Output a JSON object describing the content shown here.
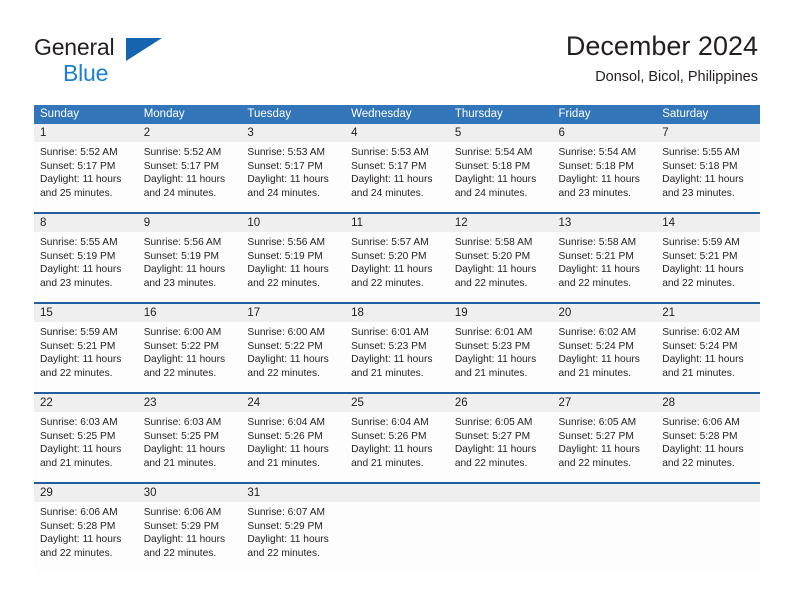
{
  "logo": {
    "word_one": "General",
    "word_two": "Blue",
    "triangle_icon": "blue-triangle-icon",
    "accent_dark": "#1464ae",
    "accent_light": "#1b7fd4"
  },
  "header": {
    "title": "December 2024",
    "subtitle": "Donsol, Bicol, Philippines"
  },
  "theme": {
    "header_blue": "#3275b9",
    "row_divider_blue": "#1f5fa0",
    "daynum_band": "#efefef",
    "text": "#231f20"
  },
  "calendar": {
    "weekday_headers": [
      "Sunday",
      "Monday",
      "Tuesday",
      "Wednesday",
      "Thursday",
      "Friday",
      "Saturday"
    ],
    "weeks": [
      [
        {
          "day": "1",
          "sunrise": "Sunrise: 5:52 AM",
          "sunset": "Sunset: 5:17 PM",
          "daylight_line1": "Daylight: 11 hours",
          "daylight_line2": "and 25 minutes."
        },
        {
          "day": "2",
          "sunrise": "Sunrise: 5:52 AM",
          "sunset": "Sunset: 5:17 PM",
          "daylight_line1": "Daylight: 11 hours",
          "daylight_line2": "and 24 minutes."
        },
        {
          "day": "3",
          "sunrise": "Sunrise: 5:53 AM",
          "sunset": "Sunset: 5:17 PM",
          "daylight_line1": "Daylight: 11 hours",
          "daylight_line2": "and 24 minutes."
        },
        {
          "day": "4",
          "sunrise": "Sunrise: 5:53 AM",
          "sunset": "Sunset: 5:17 PM",
          "daylight_line1": "Daylight: 11 hours",
          "daylight_line2": "and 24 minutes."
        },
        {
          "day": "5",
          "sunrise": "Sunrise: 5:54 AM",
          "sunset": "Sunset: 5:18 PM",
          "daylight_line1": "Daylight: 11 hours",
          "daylight_line2": "and 24 minutes."
        },
        {
          "day": "6",
          "sunrise": "Sunrise: 5:54 AM",
          "sunset": "Sunset: 5:18 PM",
          "daylight_line1": "Daylight: 11 hours",
          "daylight_line2": "and 23 minutes."
        },
        {
          "day": "7",
          "sunrise": "Sunrise: 5:55 AM",
          "sunset": "Sunset: 5:18 PM",
          "daylight_line1": "Daylight: 11 hours",
          "daylight_line2": "and 23 minutes."
        }
      ],
      [
        {
          "day": "8",
          "sunrise": "Sunrise: 5:55 AM",
          "sunset": "Sunset: 5:19 PM",
          "daylight_line1": "Daylight: 11 hours",
          "daylight_line2": "and 23 minutes."
        },
        {
          "day": "9",
          "sunrise": "Sunrise: 5:56 AM",
          "sunset": "Sunset: 5:19 PM",
          "daylight_line1": "Daylight: 11 hours",
          "daylight_line2": "and 23 minutes."
        },
        {
          "day": "10",
          "sunrise": "Sunrise: 5:56 AM",
          "sunset": "Sunset: 5:19 PM",
          "daylight_line1": "Daylight: 11 hours",
          "daylight_line2": "and 22 minutes."
        },
        {
          "day": "11",
          "sunrise": "Sunrise: 5:57 AM",
          "sunset": "Sunset: 5:20 PM",
          "daylight_line1": "Daylight: 11 hours",
          "daylight_line2": "and 22 minutes."
        },
        {
          "day": "12",
          "sunrise": "Sunrise: 5:58 AM",
          "sunset": "Sunset: 5:20 PM",
          "daylight_line1": "Daylight: 11 hours",
          "daylight_line2": "and 22 minutes."
        },
        {
          "day": "13",
          "sunrise": "Sunrise: 5:58 AM",
          "sunset": "Sunset: 5:21 PM",
          "daylight_line1": "Daylight: 11 hours",
          "daylight_line2": "and 22 minutes."
        },
        {
          "day": "14",
          "sunrise": "Sunrise: 5:59 AM",
          "sunset": "Sunset: 5:21 PM",
          "daylight_line1": "Daylight: 11 hours",
          "daylight_line2": "and 22 minutes."
        }
      ],
      [
        {
          "day": "15",
          "sunrise": "Sunrise: 5:59 AM",
          "sunset": "Sunset: 5:21 PM",
          "daylight_line1": "Daylight: 11 hours",
          "daylight_line2": "and 22 minutes."
        },
        {
          "day": "16",
          "sunrise": "Sunrise: 6:00 AM",
          "sunset": "Sunset: 5:22 PM",
          "daylight_line1": "Daylight: 11 hours",
          "daylight_line2": "and 22 minutes."
        },
        {
          "day": "17",
          "sunrise": "Sunrise: 6:00 AM",
          "sunset": "Sunset: 5:22 PM",
          "daylight_line1": "Daylight: 11 hours",
          "daylight_line2": "and 22 minutes."
        },
        {
          "day": "18",
          "sunrise": "Sunrise: 6:01 AM",
          "sunset": "Sunset: 5:23 PM",
          "daylight_line1": "Daylight: 11 hours",
          "daylight_line2": "and 21 minutes."
        },
        {
          "day": "19",
          "sunrise": "Sunrise: 6:01 AM",
          "sunset": "Sunset: 5:23 PM",
          "daylight_line1": "Daylight: 11 hours",
          "daylight_line2": "and 21 minutes."
        },
        {
          "day": "20",
          "sunrise": "Sunrise: 6:02 AM",
          "sunset": "Sunset: 5:24 PM",
          "daylight_line1": "Daylight: 11 hours",
          "daylight_line2": "and 21 minutes."
        },
        {
          "day": "21",
          "sunrise": "Sunrise: 6:02 AM",
          "sunset": "Sunset: 5:24 PM",
          "daylight_line1": "Daylight: 11 hours",
          "daylight_line2": "and 21 minutes."
        }
      ],
      [
        {
          "day": "22",
          "sunrise": "Sunrise: 6:03 AM",
          "sunset": "Sunset: 5:25 PM",
          "daylight_line1": "Daylight: 11 hours",
          "daylight_line2": "and 21 minutes."
        },
        {
          "day": "23",
          "sunrise": "Sunrise: 6:03 AM",
          "sunset": "Sunset: 5:25 PM",
          "daylight_line1": "Daylight: 11 hours",
          "daylight_line2": "and 21 minutes."
        },
        {
          "day": "24",
          "sunrise": "Sunrise: 6:04 AM",
          "sunset": "Sunset: 5:26 PM",
          "daylight_line1": "Daylight: 11 hours",
          "daylight_line2": "and 21 minutes."
        },
        {
          "day": "25",
          "sunrise": "Sunrise: 6:04 AM",
          "sunset": "Sunset: 5:26 PM",
          "daylight_line1": "Daylight: 11 hours",
          "daylight_line2": "and 21 minutes."
        },
        {
          "day": "26",
          "sunrise": "Sunrise: 6:05 AM",
          "sunset": "Sunset: 5:27 PM",
          "daylight_line1": "Daylight: 11 hours",
          "daylight_line2": "and 22 minutes."
        },
        {
          "day": "27",
          "sunrise": "Sunrise: 6:05 AM",
          "sunset": "Sunset: 5:27 PM",
          "daylight_line1": "Daylight: 11 hours",
          "daylight_line2": "and 22 minutes."
        },
        {
          "day": "28",
          "sunrise": "Sunrise: 6:06 AM",
          "sunset": "Sunset: 5:28 PM",
          "daylight_line1": "Daylight: 11 hours",
          "daylight_line2": "and 22 minutes."
        }
      ],
      [
        {
          "day": "29",
          "sunrise": "Sunrise: 6:06 AM",
          "sunset": "Sunset: 5:28 PM",
          "daylight_line1": "Daylight: 11 hours",
          "daylight_line2": "and 22 minutes."
        },
        {
          "day": "30",
          "sunrise": "Sunrise: 6:06 AM",
          "sunset": "Sunset: 5:29 PM",
          "daylight_line1": "Daylight: 11 hours",
          "daylight_line2": "and 22 minutes."
        },
        {
          "day": "31",
          "sunrise": "Sunrise: 6:07 AM",
          "sunset": "Sunset: 5:29 PM",
          "daylight_line1": "Daylight: 11 hours",
          "daylight_line2": "and 22 minutes."
        },
        {
          "day": "",
          "sunrise": "",
          "sunset": "",
          "daylight_line1": "",
          "daylight_line2": ""
        },
        {
          "day": "",
          "sunrise": "",
          "sunset": "",
          "daylight_line1": "",
          "daylight_line2": ""
        },
        {
          "day": "",
          "sunrise": "",
          "sunset": "",
          "daylight_line1": "",
          "daylight_line2": ""
        },
        {
          "day": "",
          "sunrise": "",
          "sunset": "",
          "daylight_line1": "",
          "daylight_line2": ""
        }
      ]
    ]
  }
}
